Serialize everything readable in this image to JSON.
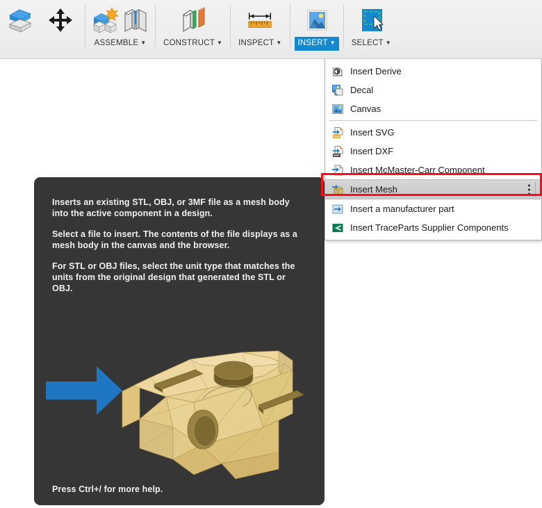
{
  "toolbar": {
    "groups": [
      {
        "name": "modify-group",
        "items": [
          {
            "icon": "split-body-icon",
            "label": "",
            "has_caret": false,
            "active": false
          },
          {
            "icon": "move-copy-icon",
            "label": "",
            "has_caret": false,
            "active": false
          }
        ]
      },
      {
        "name": "assemble-group",
        "label": "ASSEMBLE",
        "has_caret": true,
        "active": false,
        "items": [
          {
            "icon": "new-component-icon"
          },
          {
            "icon": "joint-icon"
          }
        ]
      },
      {
        "name": "construct-group",
        "label": "CONSTRUCT",
        "has_caret": true,
        "active": false,
        "items": [
          {
            "icon": "offset-plane-icon"
          }
        ]
      },
      {
        "name": "inspect-group",
        "label": "INSPECT",
        "has_caret": true,
        "active": false,
        "items": [
          {
            "icon": "measure-icon"
          }
        ]
      },
      {
        "name": "insert-group",
        "label": "INSERT",
        "has_caret": true,
        "active": true,
        "items": [
          {
            "icon": "insert-image-icon"
          }
        ]
      },
      {
        "name": "select-group",
        "label": "SELECT",
        "has_caret": true,
        "active": false,
        "items": [
          {
            "icon": "select-window-icon"
          }
        ]
      }
    ],
    "caret_glyph": "▼",
    "labels": {
      "assemble": "ASSEMBLE",
      "construct": "CONSTRUCT",
      "inspect": "INSPECT",
      "insert": "INSERT",
      "select": "SELECT"
    }
  },
  "insert_menu": {
    "items": [
      {
        "label": "Insert Derive",
        "icon": "insert-derive-icon",
        "highlighted": false,
        "separator_after": false
      },
      {
        "label": "Decal",
        "icon": "decal-icon",
        "highlighted": false,
        "separator_after": false
      },
      {
        "label": "Canvas",
        "icon": "canvas-icon",
        "highlighted": false,
        "separator_after": true
      },
      {
        "label": "Insert SVG",
        "icon": "insert-svg-icon",
        "highlighted": false,
        "separator_after": false
      },
      {
        "label": "Insert DXF",
        "icon": "insert-dxf-icon",
        "highlighted": false,
        "separator_after": false
      },
      {
        "label": "Insert McMaster-Carr Component",
        "icon": "insert-mcmaster-carr-icon",
        "highlighted": false,
        "separator_after": false
      },
      {
        "label": "Insert Mesh",
        "icon": "insert-mesh-icon",
        "highlighted": true,
        "separator_after": false,
        "overflow": "three-dots"
      },
      {
        "label": "Insert a manufacturer part",
        "icon": "insert-manufacturer-part-icon",
        "highlighted": false,
        "separator_after": false
      },
      {
        "label": "Insert TraceParts Supplier Components",
        "icon": "insert-traceparts-icon",
        "highlighted": false,
        "separator_after": false
      }
    ]
  },
  "annotation": {
    "name": "red-highlight-box",
    "color": "#fa0f19",
    "targets": "Insert Mesh"
  },
  "tooltip": {
    "paragraphs": [
      "Inserts an existing STL, OBJ, or 3MF file as a mesh body into the active component in a design.",
      "Select a file to insert. The contents of the file displays as a mesh body in the canvas and the browser.",
      "For STL or OBJ files, select the unit type that matches the units from the original design that generated the STL or OBJ."
    ],
    "footer": "Press Ctrl+/ for more help.",
    "figure": {
      "name": "mesh-body-preview",
      "arrow_color": "#1f77c4",
      "mesh_color": "#e8cd87",
      "background": "#363636"
    }
  },
  "colors": {
    "accent_blue": "#1589d0",
    "toolbar_bg": "#eeeeee",
    "tooltip_bg": "#363636",
    "annotation_red": "#fa0f19",
    "menu_bg": "#ffffff",
    "menu_highlight": "#cfcfcf"
  }
}
